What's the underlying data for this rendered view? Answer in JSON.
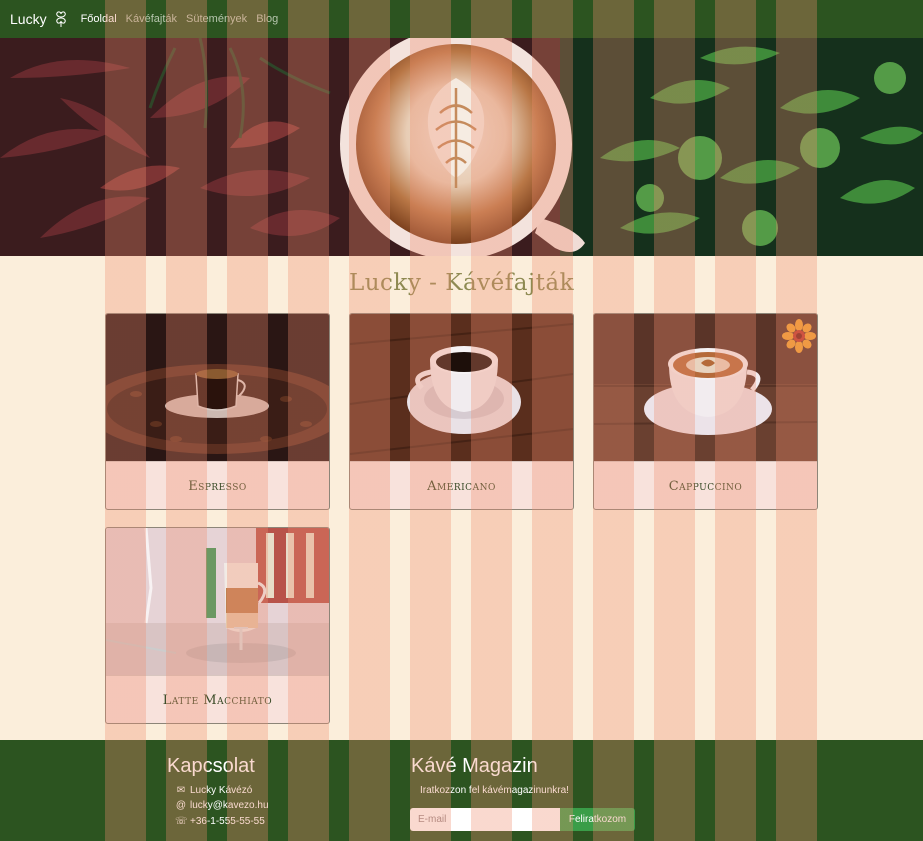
{
  "nav": {
    "brand": "Lucky",
    "links": [
      "Főoldal",
      "Kávéfajták",
      "Sütemények",
      "Blog"
    ],
    "active_index": 0
  },
  "hero": {
    "image": "latte-art-cup-with-plants"
  },
  "main": {
    "title": "Lucky - Kávéfajták",
    "cards": [
      {
        "name": "Espresso",
        "image": "espresso-cup-on-coffee-beans"
      },
      {
        "name": "Americano",
        "image": "black-coffee-cup-on-wood"
      },
      {
        "name": "Cappuccino",
        "image": "cappuccino-cup-with-flower"
      },
      {
        "name": "Latte Macchiato",
        "image": "latte-macchiato-glass"
      }
    ]
  },
  "footer": {
    "contact": {
      "title": "Kapcsolat",
      "items": [
        {
          "icon": "envelope-icon",
          "text": "Lucky Kávézó"
        },
        {
          "icon": "at-icon",
          "text": "lucky@kavezo.hu"
        },
        {
          "icon": "phone-icon",
          "text": "+36-1-555-55-55"
        }
      ]
    },
    "newsletter": {
      "title": "Kávé Magazin",
      "text": "Iratkozzon fel kávémagazinunkra!",
      "placeholder": "E-mail",
      "button": "Feliratkozom"
    }
  },
  "colors": {
    "nav_bg": "#2c5420",
    "page_bg": "#fbeedb",
    "title": "#8e8a52",
    "card_label": "#384a26",
    "button": "#3a9d48"
  }
}
